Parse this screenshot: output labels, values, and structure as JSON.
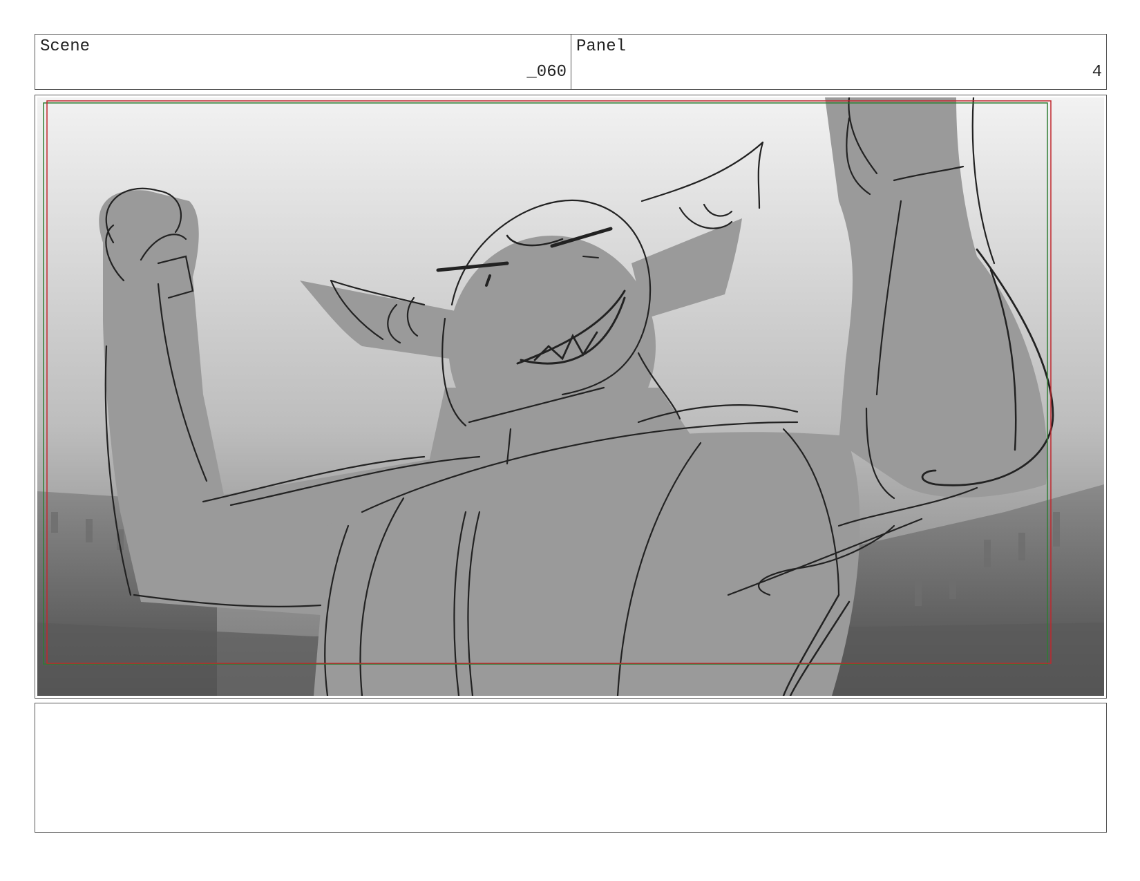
{
  "scene": {
    "label": "Scene",
    "number": "_060"
  },
  "panel": {
    "label": "Panel",
    "number": "4"
  },
  "artwork": {
    "subject": "rough sketch of horned creature flexing both arms",
    "safe_frame_color": "#c0272d",
    "action_frame_color": "#2e7d32"
  },
  "notes": {
    "text": ""
  }
}
